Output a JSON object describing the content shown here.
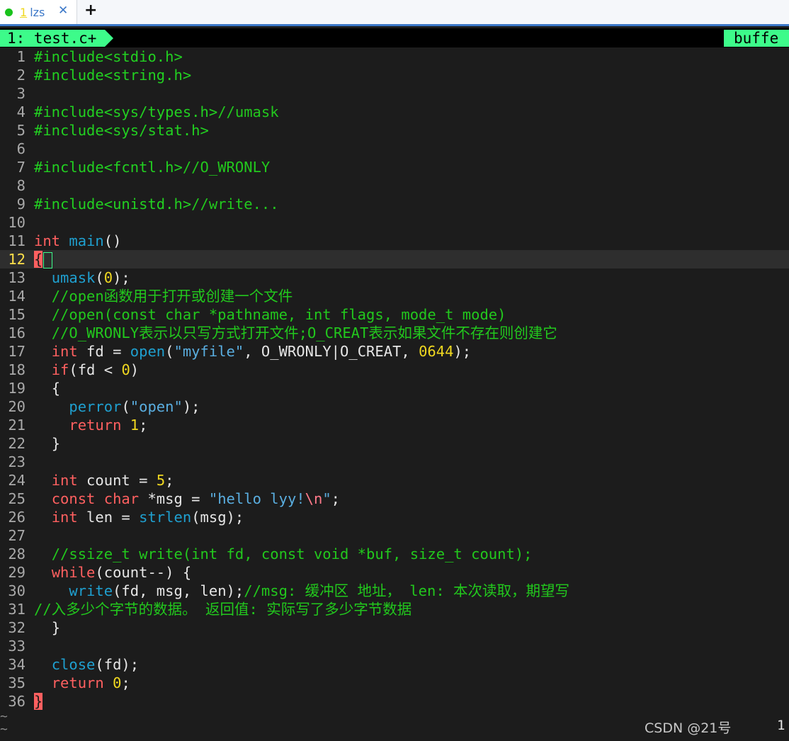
{
  "terminal": {
    "tab_number": "1",
    "tab_title": "lzs",
    "close_glyph": "✕",
    "add_glyph": "+",
    "status_dot_color": "#19c21b"
  },
  "vim": {
    "active_tab": "1: test.c+",
    "right_tab": "buffe",
    "current_line": 12
  },
  "code": {
    "l1": "#include<stdio.h>",
    "l2": "#include<string.h>",
    "l4a": "#include<sys/types.h>",
    "l4b": "//umask",
    "l5": "#include<sys/stat.h>",
    "l7a": "#include<fcntl.h>",
    "l7b": "//O_WRONLY",
    "l9a": "#include<unistd.h>",
    "l9b": "//write...",
    "l11_type": "int",
    "l11_fn": "main",
    "l11_rest": "()",
    "l12": "{",
    "l13_fn": "umask",
    "l13_num": "0",
    "l14": "//open函数用于打开或创建一个文件",
    "l15": "//open(const char *pathname, int flags, mode_t mode)",
    "l16": "//O_WRONLY表示以只写方式打开文件;O_CREAT表示如果文件不存在则创建它",
    "l17_type": "int",
    "l17_a": " fd = ",
    "l17_fn": "open",
    "l17_str": "\"myfile\"",
    "l17_b": ", O_WRONLY|O_CREAT, ",
    "l17_num": "0644",
    "l17_c": ");",
    "l18_kw": "if",
    "l18_a": "(fd < ",
    "l18_num": "0",
    "l18_b": ")",
    "l19": "{",
    "l20_fn": "perror",
    "l20_str": "\"open\"",
    "l21_kw": "return",
    "l21_num": "1",
    "l22": "}",
    "l24_type": "int",
    "l24_a": " count = ",
    "l24_num": "5",
    "l25_kw1": "const",
    "l25_kw2": "char",
    "l25_a": " *msg = ",
    "l25_str1": "\"hello lyy!",
    "l25_esc": "\\n",
    "l25_str2": "\"",
    "l26_type": "int",
    "l26_a": " len = ",
    "l26_fn": "strlen",
    "l26_b": "(msg);",
    "l28": "//ssize_t write(int fd, const void *buf, size_t count);",
    "l29_kw": "while",
    "l29_a": "(count--) {",
    "l30_fn": "write",
    "l30_a": "(fd, msg, len);",
    "l30_cmt": "//msg: 缓冲区 地址， len: 本次读取，期望写",
    "l31": "//入多少个字节的数据。 返回值: 实际写了多少字节数据",
    "l32": "}",
    "l34_fn": "close",
    "l34_a": "(fd);",
    "l35_kw": "return",
    "l35_num": "0",
    "l36": "}"
  },
  "footer": {
    "tilde": "~",
    "watermark": "CSDN @21号",
    "ruler": "1"
  }
}
